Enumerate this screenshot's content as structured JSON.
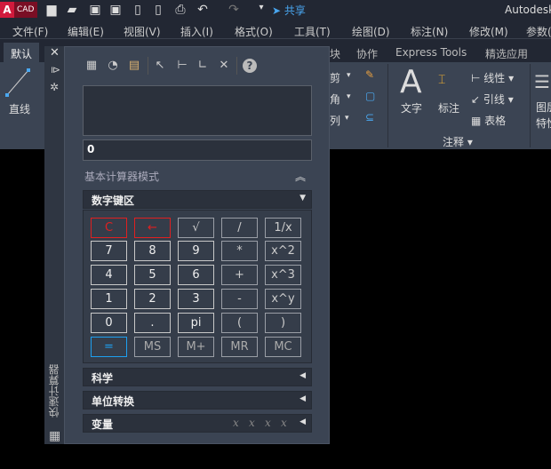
{
  "title_bar": {
    "logo": "A",
    "logo_sub": "CAD",
    "share": "共享",
    "app_title": "Autodesk"
  },
  "menu": [
    "文件(F)",
    "编辑(E)",
    "视图(V)",
    "插入(I)",
    "格式(O)",
    "工具(T)",
    "绘图(D)",
    "标注(N)",
    "修改(M)",
    "参数("
  ],
  "ribbon_tabs": [
    "默认",
    "块",
    "协作",
    "Express Tools",
    "精选应用"
  ],
  "ribbon": {
    "line": "直线",
    "trim": "剪",
    "fillet": "角",
    "array": "列",
    "text": "文字",
    "dimension": "标注",
    "linear": "线性",
    "leader": "引线",
    "table": "表格",
    "annotation_panel": "注释",
    "layer_props": "图层",
    "layer_props2": "特性"
  },
  "calculator": {
    "title": "快速计算器",
    "help": "?",
    "input_value": "0",
    "mode_label": "基本计算器模式",
    "keypad_label": "数字键区",
    "keys": [
      [
        "C",
        "←",
        "√",
        "/",
        "1/x"
      ],
      [
        "7",
        "8",
        "9",
        "*",
        "x^2"
      ],
      [
        "4",
        "5",
        "6",
        "+",
        "x^3"
      ],
      [
        "1",
        "2",
        "3",
        "-",
        "x^y"
      ],
      [
        "0",
        ".",
        "pi",
        "(",
        ")"
      ],
      [
        "=",
        "MS",
        "M+",
        "MR",
        "MC"
      ]
    ],
    "sections": [
      "科学",
      "单位转换",
      "变量"
    ]
  }
}
